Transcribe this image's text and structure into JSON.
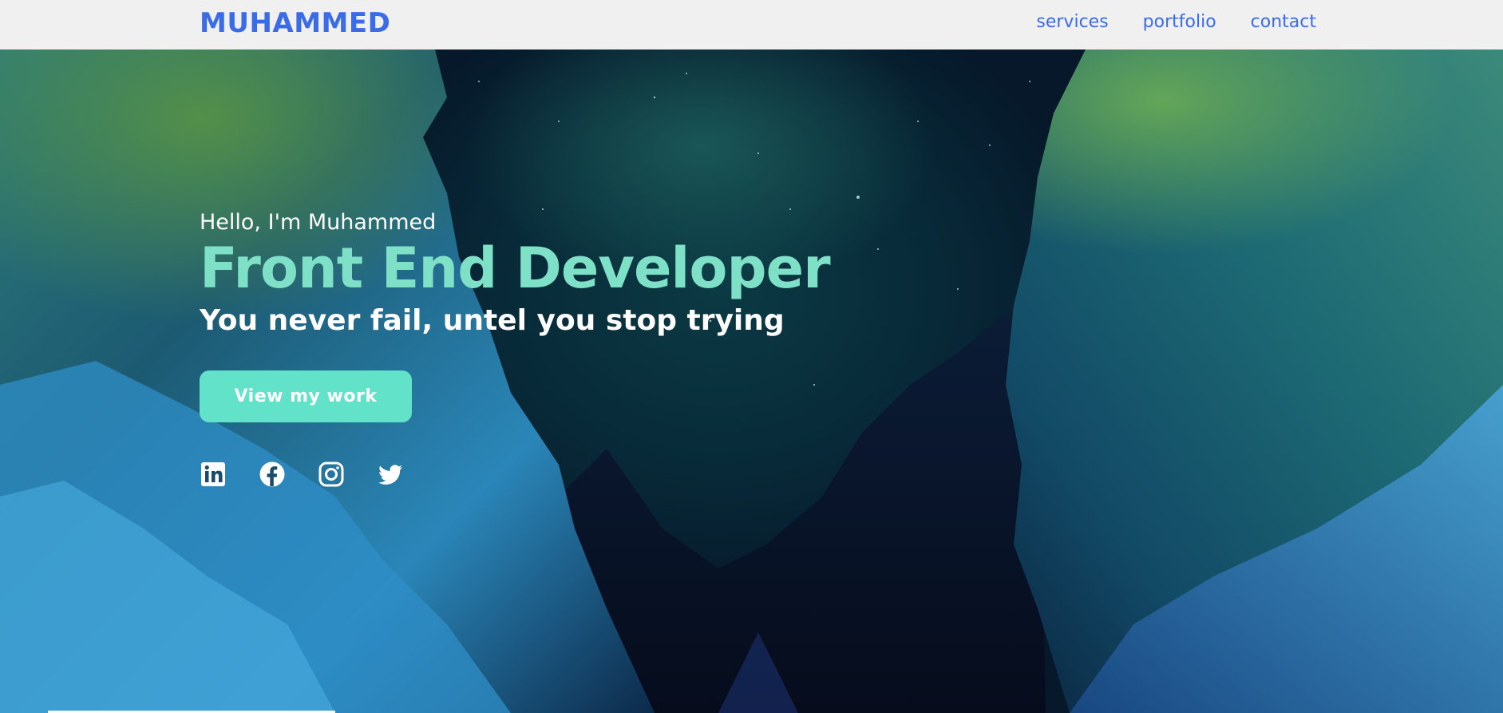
{
  "navbar": {
    "brand": "MUHAMMED",
    "links": [
      "services",
      "portfolio",
      "contact"
    ]
  },
  "hero": {
    "greeting": "Hello, I'm Muhammed",
    "title": "Front End Developer",
    "tagline": "You never fail, untel you stop trying",
    "cta_label": "View my work",
    "socials": [
      "linkedin-icon",
      "facebook-icon",
      "instagram-icon",
      "twitter-icon"
    ]
  },
  "colors": {
    "brand": "#3b6ce8",
    "nav_bg": "#f0f0f0",
    "title": "#7ee0c6",
    "cta_bg": "#62e2c8",
    "text": "#ffffff"
  }
}
